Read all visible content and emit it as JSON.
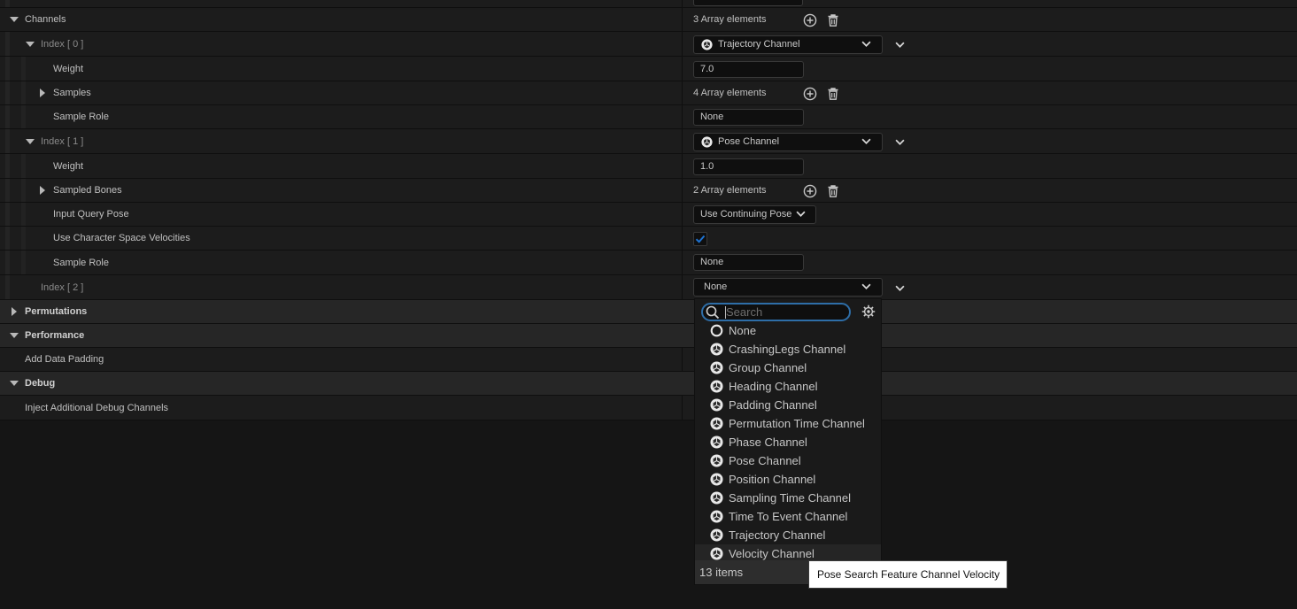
{
  "channels_label": "Channels",
  "channels_value": "3 Array elements",
  "index0": {
    "label": "Index [ 0 ]",
    "type": "Trajectory Channel",
    "weight_label": "Weight",
    "weight_value": "7.0",
    "samples_label": "Samples",
    "samples_value": "4 Array elements",
    "sample_role_label": "Sample Role",
    "sample_role_value": "None"
  },
  "index1": {
    "label": "Index [ 1 ]",
    "type": "Pose Channel",
    "weight_label": "Weight",
    "weight_value": "1.0",
    "bones_label": "Sampled Bones",
    "bones_value": "2 Array elements",
    "query_label": "Input Query Pose",
    "query_value": "Use Continuing Pose",
    "velocities_label": "Use Character Space Velocities",
    "velocities_checked": true,
    "sample_role_label": "Sample Role",
    "sample_role_value": "None"
  },
  "index2": {
    "label": "Index [ 2 ]",
    "type": "None"
  },
  "sections": {
    "permutations": "Permutations",
    "performance": "Performance",
    "add_data_padding": "Add Data Padding",
    "debug": "Debug",
    "inject_debug": "Inject Additional Debug Channels"
  },
  "dropdown": {
    "search_placeholder": "Search",
    "items": [
      {
        "label": "None",
        "icon": "none-circle-icon"
      },
      {
        "label": "CrashingLegs Channel",
        "icon": "channel-icon"
      },
      {
        "label": "Group Channel",
        "icon": "channel-icon"
      },
      {
        "label": "Heading Channel",
        "icon": "channel-icon"
      },
      {
        "label": "Padding Channel",
        "icon": "channel-icon"
      },
      {
        "label": "Permutation Time Channel",
        "icon": "channel-icon"
      },
      {
        "label": "Phase Channel",
        "icon": "channel-icon"
      },
      {
        "label": "Pose Channel",
        "icon": "channel-icon"
      },
      {
        "label": "Position Channel",
        "icon": "channel-icon"
      },
      {
        "label": "Sampling Time Channel",
        "icon": "channel-icon"
      },
      {
        "label": "Time To Event Channel",
        "icon": "channel-icon"
      },
      {
        "label": "Trajectory Channel",
        "icon": "channel-icon"
      },
      {
        "label": "Velocity Channel",
        "icon": "channel-icon"
      }
    ],
    "count": "13 items",
    "tooltip": "Pose Search Feature Channel Velocity"
  },
  "colors": {
    "accent": "#2e6ea8",
    "check": "#1e73d2"
  }
}
